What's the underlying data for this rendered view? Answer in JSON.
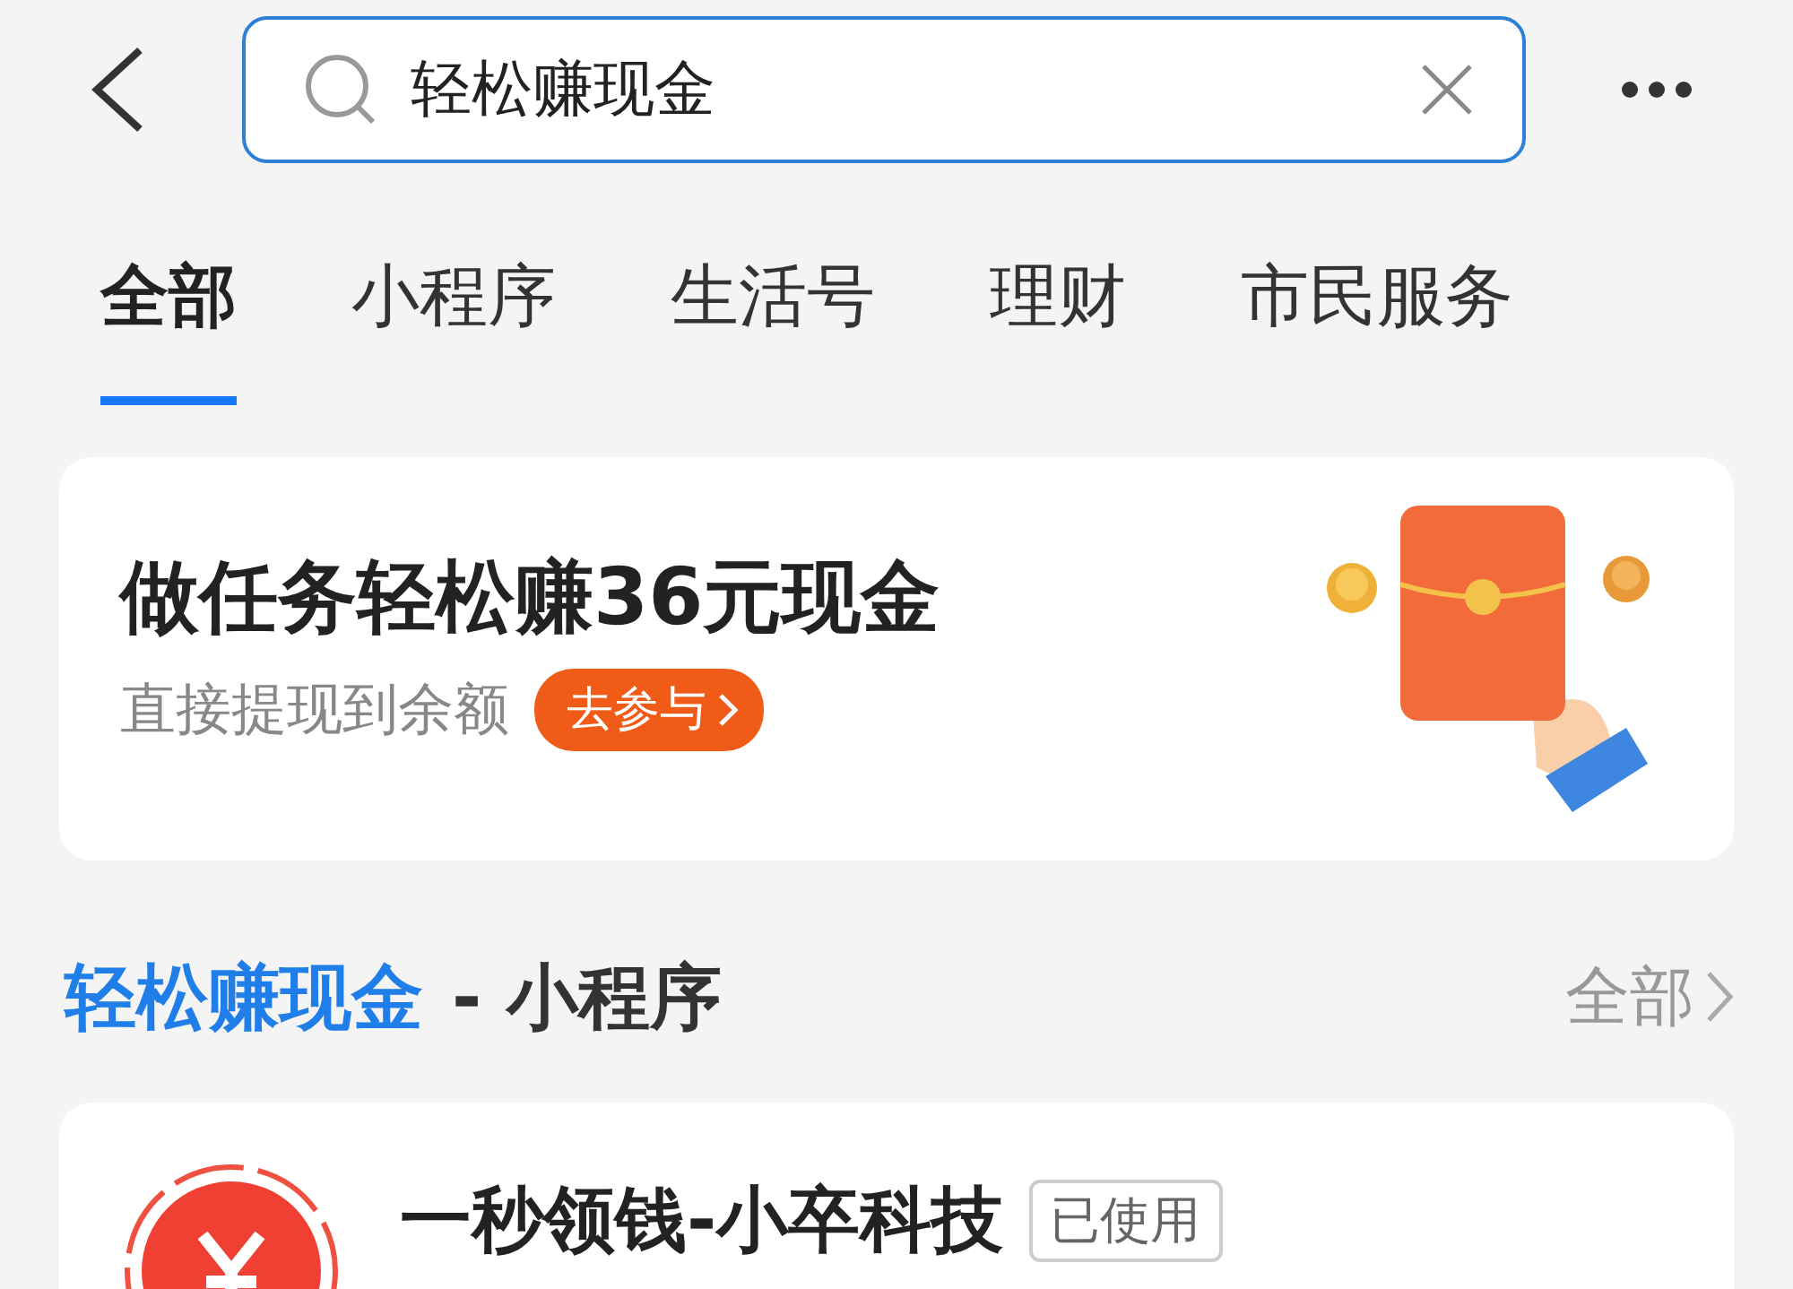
{
  "search": {
    "value": "轻松赚现金"
  },
  "tabs": [
    {
      "label": "全部",
      "selected": true
    },
    {
      "label": "小程序",
      "selected": false
    },
    {
      "label": "生活号",
      "selected": false
    },
    {
      "label": "理财",
      "selected": false
    },
    {
      "label": "市民服务",
      "selected": false
    }
  ],
  "banner": {
    "title": "做任务轻松赚36元现金",
    "subtitle": "直接提现到余额",
    "button": "去参与"
  },
  "section": {
    "query": "轻松赚现金",
    "suffix": "- 小程序",
    "more": "全部"
  },
  "results": [
    {
      "title": "一秒领钱-小卒科技",
      "badge": "已使用"
    }
  ]
}
